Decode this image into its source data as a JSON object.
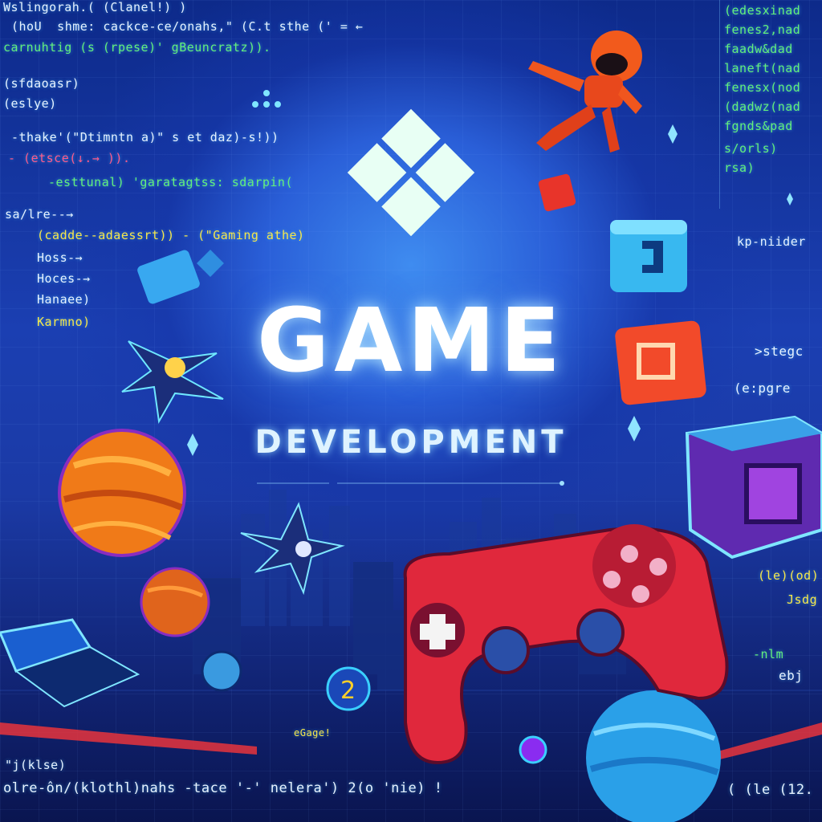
{
  "poster": {
    "title": "GAME",
    "subtitle": "DEVELOPMENT"
  },
  "code_left": [
    "Wslingorah.( (Clanel!) )",
    "(hoU  shme: cackce-ce/onahs,\" (C.t sthe (' = ←",
    "carnuhtig (s (rpese)' gBeuncratz)).",
    "(sfdaoasr)",
    "(eslye)",
    "-thake'(\"Dtimntn a)\" s et daz)-s!))",
    "- (etsce(↓.→ )).",
    "-esttunal) 'garatagtss: sdarpin(",
    "sa/lre--→",
    "(cadde--adaessrt)) - (\"Gaming athe)",
    "Hoss-→",
    "Hoces-→",
    "Hanaee)",
    "Karmno)",
    "\"j(klse)",
    "olre-ôn/(klothl)nahs -tace '-' nelera') 2(o 'nie) !",
    "eGage!"
  ],
  "code_right": [
    "(edesxinad",
    "fenes2,nad",
    "faadw&dad",
    "laneft(nad",
    "fenesx(nod",
    "(dadwz(nad",
    "fgnds&pad",
    "s/orls)",
    "rsa)",
    "kp-niider",
    ">stegc",
    "(e:pgre",
    "(le)(od)",
    "Jsdg",
    "ebj",
    "( (le (12.",
    "-nlm"
  ],
  "colors": {
    "controller": "#e0283c",
    "controller_buttons": "#f2a9c8",
    "planet_orange": "#f08a1e",
    "planet_blue": "#2aa8e8",
    "cube_blue": "#33b8f0",
    "cube_red": "#f24a2a",
    "robot": "#f04a1c"
  },
  "icons": [
    "diamond-logo-icon",
    "robot-icon",
    "gamepad-icon",
    "planet-icon",
    "cube-icon",
    "star-ship-icon",
    "laptop-icon"
  ]
}
